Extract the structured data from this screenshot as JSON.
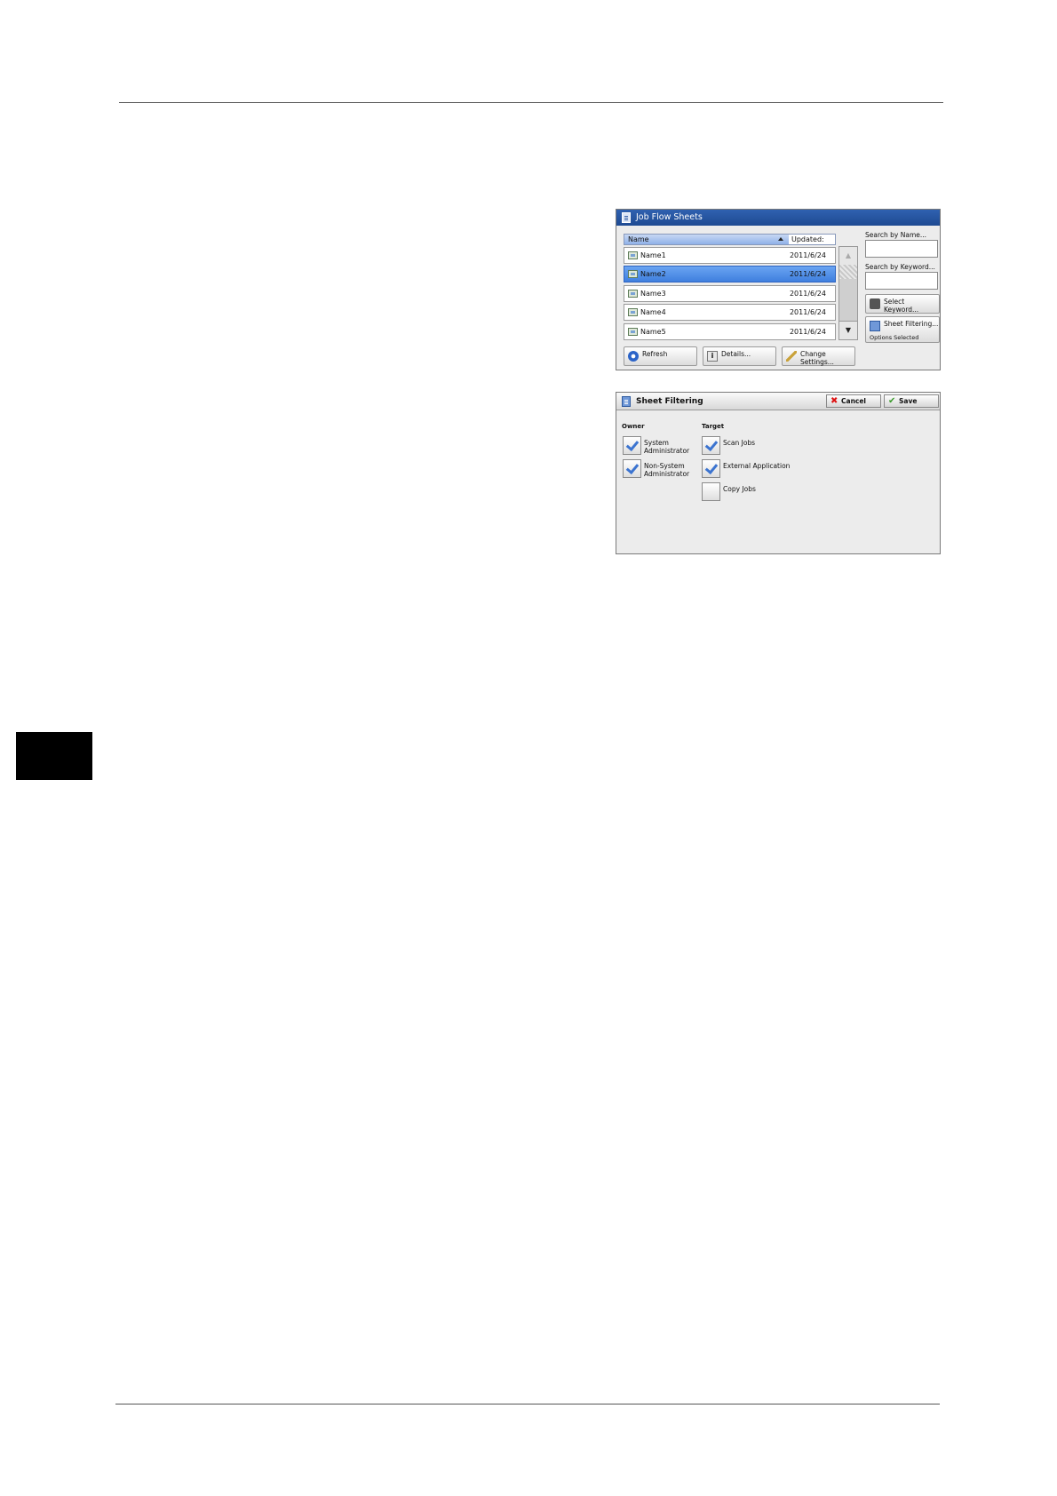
{
  "job_flow_sheets": {
    "title": "Job Flow Sheets",
    "header": {
      "name": "Name",
      "updated": "Updated:"
    },
    "rows": [
      {
        "name": "Name1",
        "date": "2011/6/24"
      },
      {
        "name": "Name2",
        "date": "2011/6/24"
      },
      {
        "name": "Name3",
        "date": "2011/6/24"
      },
      {
        "name": "Name4",
        "date": "2011/6/24"
      },
      {
        "name": "Name5",
        "date": "2011/6/24"
      }
    ],
    "selected_row": "Name2",
    "search_by_name_label": "Search by Name...",
    "search_by_keyword_label": "Search by Keyword...",
    "select_keyword_label": [
      "Select",
      "Keyword..."
    ],
    "sheet_filtering_label": "Sheet Filtering...",
    "sheet_filtering_status": "Options Selected",
    "refresh_label": "Refresh",
    "details_label": "Details...",
    "change_settings_label": [
      "Change",
      "Settings..."
    ]
  },
  "sheet_filtering": {
    "title": "Sheet Filtering",
    "cancel_label": "Cancel",
    "save_label": "Save",
    "owner_label": "Owner",
    "target_label": "Target",
    "owner_options": [
      {
        "label": [
          "System",
          "Administrator"
        ],
        "checked": true
      },
      {
        "label": [
          "Non-System",
          "Administrator"
        ],
        "checked": true
      }
    ],
    "target_options": [
      {
        "label": "Scan Jobs",
        "checked": true
      },
      {
        "label": "External Application",
        "checked": true
      },
      {
        "label": "Copy Jobs",
        "checked": false
      }
    ]
  }
}
